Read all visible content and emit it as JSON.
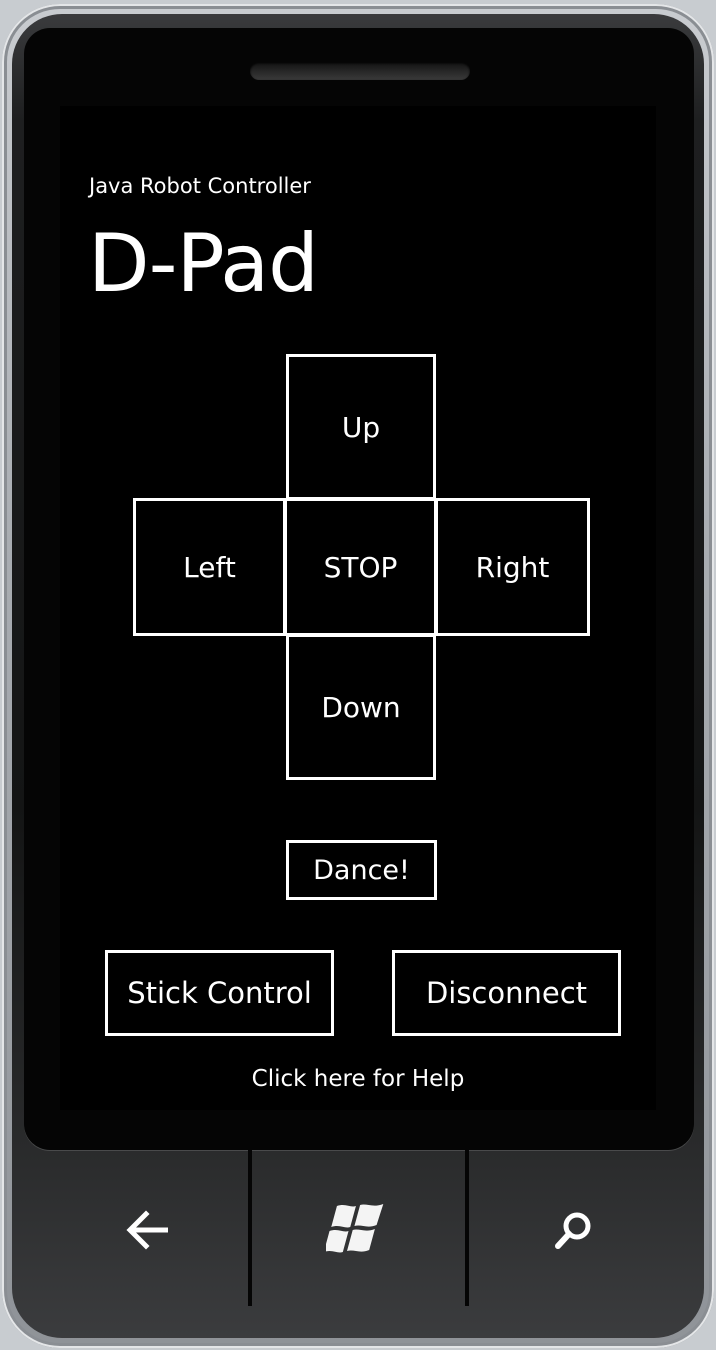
{
  "app": {
    "name": "Java Robot Controller",
    "page_title": "D-Pad"
  },
  "dpad": {
    "up": "Up",
    "left": "Left",
    "stop": "STOP",
    "right": "Right",
    "down": "Down"
  },
  "actions": {
    "dance": "Dance!",
    "stick_control": "Stick Control",
    "disconnect": "Disconnect",
    "help": "Click here for Help"
  },
  "hardware_buttons": {
    "back_icon": "back-arrow-icon",
    "start_icon": "windows-logo-icon",
    "search_icon": "search-icon"
  },
  "colors": {
    "screen_background": "#000000",
    "foreground": "#ffffff"
  }
}
